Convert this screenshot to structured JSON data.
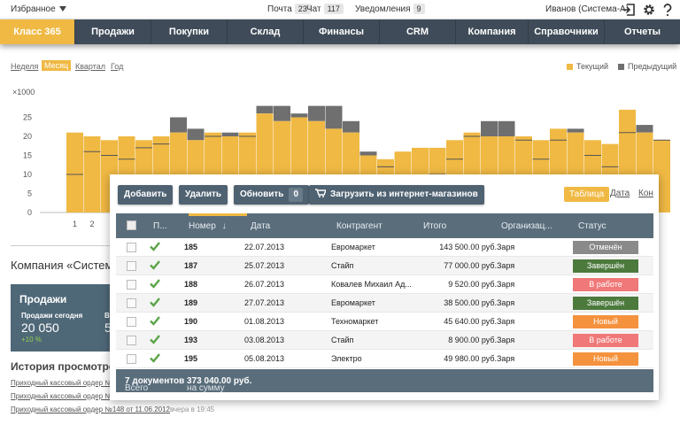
{
  "topbar": {
    "favorites": "Избранное",
    "mail_label": "Почта",
    "mail_count": "23",
    "chat_label": "Чат",
    "chat_count": "117",
    "notif_label": "Уведомления",
    "notif_count": "9",
    "user": "Иванов (Система-А)",
    "icons": [
      "logout-icon",
      "gear-icon",
      "help-icon"
    ]
  },
  "nav": {
    "items": [
      "Класс 365",
      "Продажи",
      "Покупки",
      "Склад",
      "Финансы",
      "CRM",
      "Компания",
      "Справочники",
      "Отчеты"
    ],
    "active": "Класс 365"
  },
  "period_tabs": [
    "Неделя",
    "Месяц",
    "Квартал",
    "Год"
  ],
  "period_active": "Месяц",
  "legend": {
    "current": "Текущий",
    "current_color": "#f0b944",
    "previous": "Предыдущий",
    "previous_color": "#6f6f6f"
  },
  "chart_data": {
    "type": "bar",
    "multiplier_label": "×1000",
    "yticks": [
      "0",
      "5",
      "10",
      "15",
      "20",
      "25"
    ],
    "ylim": [
      0,
      30
    ],
    "x_visible_labels": [
      "1",
      "2"
    ],
    "series": [
      {
        "name": "Текущий",
        "values": [
          21,
          20,
          19,
          20,
          19,
          20,
          21,
          19,
          21,
          20,
          21,
          26,
          24,
          25,
          24,
          22,
          21,
          15,
          14,
          16,
          17,
          17,
          19,
          21,
          20,
          20,
          20,
          19,
          22,
          21,
          19,
          18,
          27,
          21,
          19
        ]
      },
      {
        "name": "Предыдущий",
        "values": [
          10,
          16,
          15,
          14,
          17,
          18,
          25,
          22,
          20,
          21,
          20,
          28,
          28,
          26,
          28,
          28,
          24,
          16,
          12,
          8,
          8,
          10,
          14,
          20,
          24,
          24,
          19,
          14,
          19,
          22,
          15,
          12,
          21,
          23,
          19
        ]
      }
    ]
  },
  "background": {
    "company_title": "Компания «Система",
    "sales_title": "Продажи",
    "sales_today_label": "Продажи сегодня",
    "sales_today_value": "20 050",
    "sales_today_pct": "+10 %",
    "second_label": "В",
    "second_value": "5",
    "history_title": "История просмотро",
    "history": [
      {
        "text": "Приходный кассовый ордер №",
        "when": ""
      },
      {
        "text": "Приходный кассовый ордер №",
        "when": ""
      },
      {
        "text": "Приходный кассовый ордер №148 от 11.06.2012",
        "when": "вчера в 19:45"
      }
    ]
  },
  "toolbar": {
    "add": "Добавить",
    "delete": "Удалить",
    "refresh": "Обновить",
    "refresh_count": "0",
    "import": "Загрузить из интернет-магазинов",
    "views": [
      "Таблица",
      "Дата",
      "Кон"
    ],
    "view_active": "Таблица"
  },
  "table": {
    "headers": {
      "p": "П...",
      "number": "Номер",
      "date": "Дата",
      "contractor": "Контрагент",
      "total": "Итого",
      "org": "Организац...",
      "status": "Статус"
    },
    "rows": [
      {
        "number": "185",
        "date": "22.07.2013",
        "contractor": "Евромаркет",
        "total": "143 500.00 руб.",
        "org": "Заря",
        "status": "Отменён",
        "status_color": "#8a8a8a"
      },
      {
        "number": "187",
        "date": "25.07.2013",
        "contractor": "Стайп",
        "total": "77 000.00 руб.",
        "org": "Заря",
        "status": "Завершён",
        "status_color": "#4c7a3d"
      },
      {
        "number": "188",
        "date": "26.07.2013",
        "contractor": "Ковалев Михаил Ад...",
        "total": "9 520.00 руб.",
        "org": "Заря",
        "status": "В работе",
        "status_color": "#f07878"
      },
      {
        "number": "189",
        "date": "27.07.2013",
        "contractor": "Евромаркет",
        "total": "38 500.00 руб.",
        "org": "Заря",
        "status": "Завершён",
        "status_color": "#4c7a3d"
      },
      {
        "number": "190",
        "date": "01.08.2013",
        "contractor": "Техномаркет",
        "total": "45 640.00 руб.",
        "org": "Заря",
        "status": "Новый",
        "status_color": "#f5923e"
      },
      {
        "number": "193",
        "date": "03.08.2013",
        "contractor": "Стайп",
        "total": "8 900.00 руб.",
        "org": "Заря",
        "status": "В работе",
        "status_color": "#f07878"
      },
      {
        "number": "195",
        "date": "05.08.2013",
        "contractor": "Электро",
        "total": "49 980.00 руб.",
        "org": "Заря",
        "status": "Новый",
        "status_color": "#f5923e"
      }
    ],
    "footer_prefix": "Всего",
    "footer_count": "7 документов",
    "footer_mid": "на сумму",
    "footer_sum": "373 040.00 руб."
  }
}
